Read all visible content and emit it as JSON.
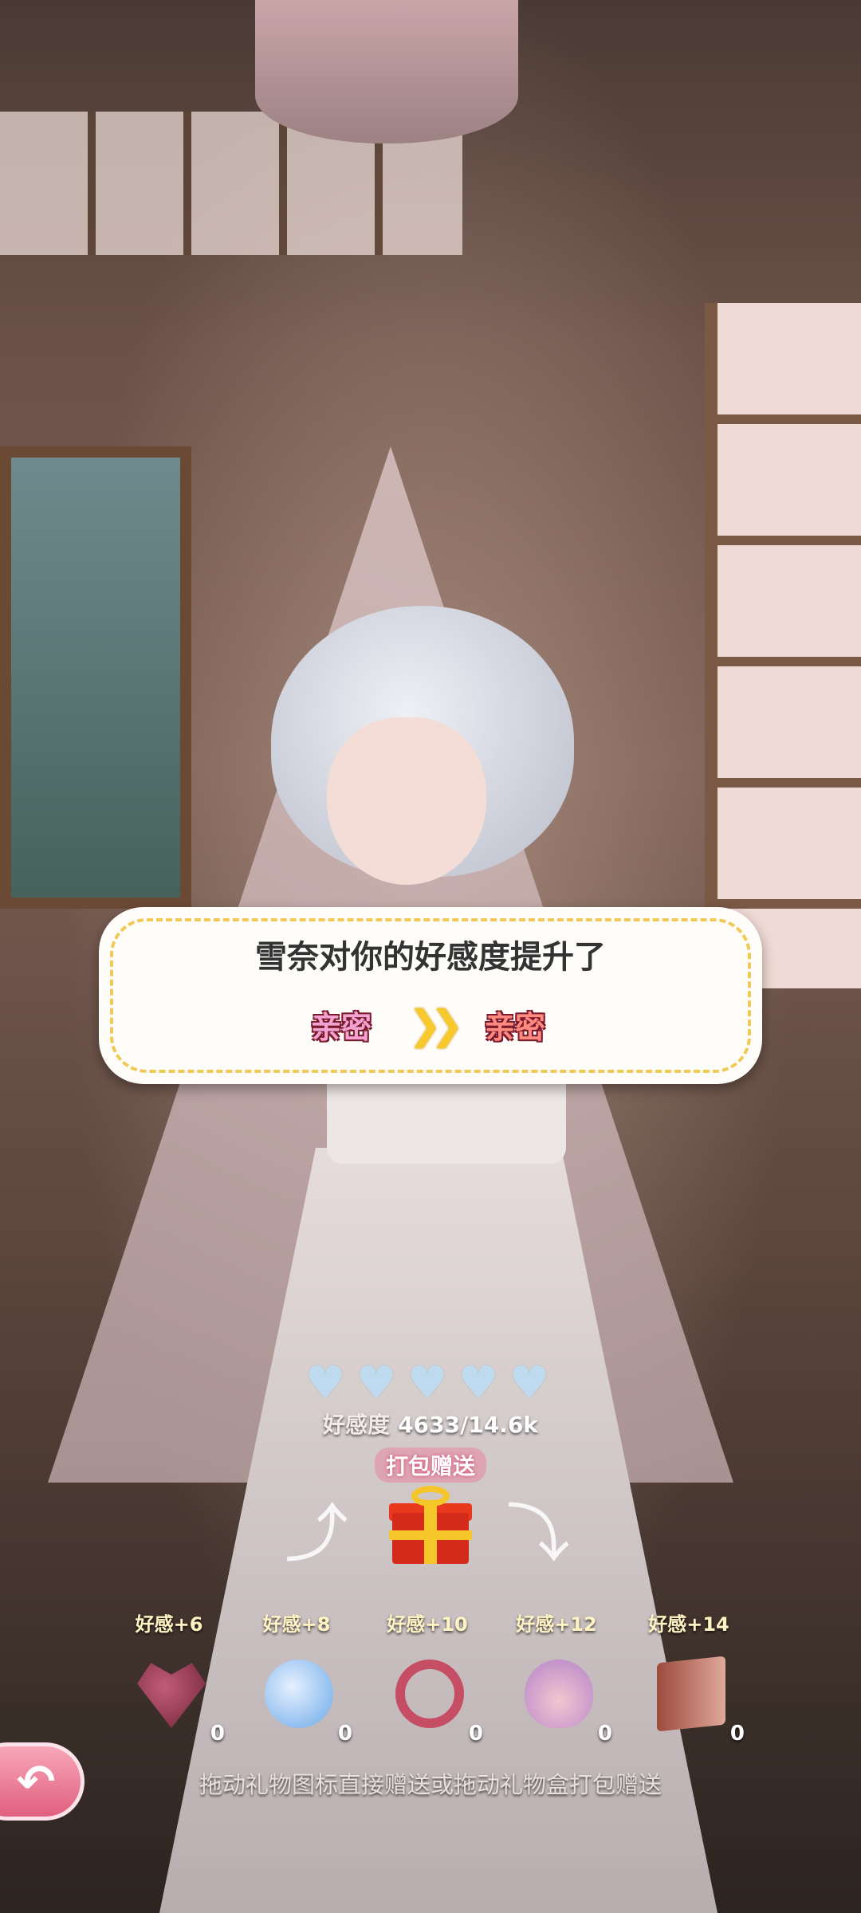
{
  "toast": {
    "title": "雪奈对你的好感度提升了",
    "from_level": "亲密",
    "to_level": "亲密",
    "arrow_icon": "double-chevron-right-icon"
  },
  "affection": {
    "hearts_total": 5,
    "hearts_filled": 0,
    "label": "好感度",
    "value": "4633/14.6k"
  },
  "pack": {
    "label": "打包赠送",
    "icon": "gift-box-icon"
  },
  "gifts": [
    {
      "bonus": "好感+6",
      "count": "0",
      "icon": "heart-chocolate-box-icon"
    },
    {
      "bonus": "好感+8",
      "count": "0",
      "icon": "candy-wrapper-icon"
    },
    {
      "bonus": "好感+10",
      "count": "0",
      "icon": "bow-ring-icon"
    },
    {
      "bonus": "好感+12",
      "count": "0",
      "icon": "origami-bottle-icon"
    },
    {
      "bonus": "好感+14",
      "count": "0",
      "icon": "diary-book-icon"
    }
  ],
  "hint": "拖动礼物图标直接赠送或拖动礼物盒打包赠送",
  "colors": {
    "toast_border": "#f1c956",
    "level_old": "#f3a3d2",
    "level_new": "#ff8a7f",
    "back_button": "#e0607f"
  }
}
